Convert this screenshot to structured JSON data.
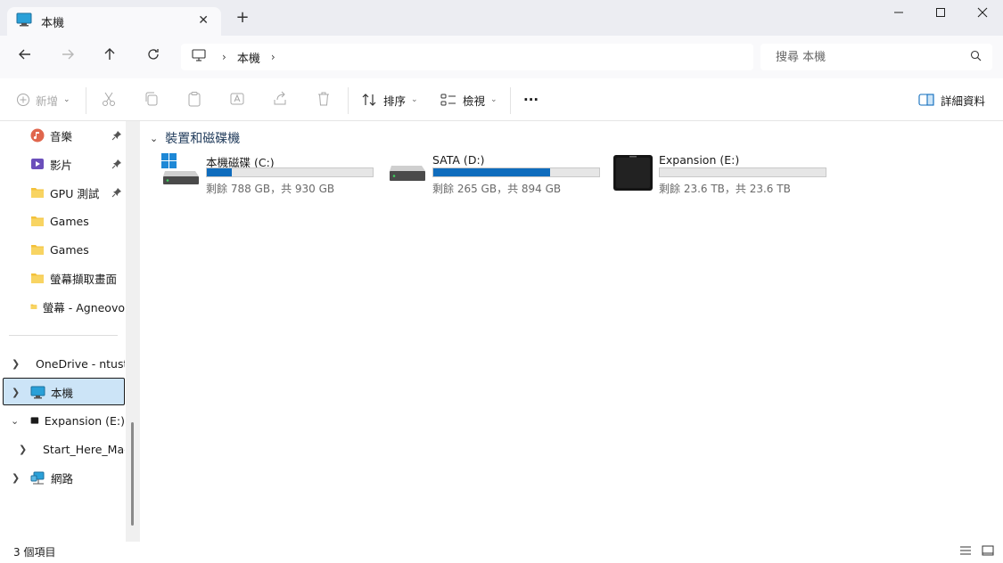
{
  "window": {
    "tab_title": "本機",
    "tab_close": "✕",
    "new_tab": "+"
  },
  "address": {
    "crumbs": [
      "本機"
    ]
  },
  "search": {
    "placeholder": "搜尋 本機"
  },
  "toolbar": {
    "new_label": "新增",
    "sort_label": "排序",
    "view_label": "檢視",
    "more_label": "···",
    "details_label": "詳細資料"
  },
  "sidebar": {
    "quick_access": [
      {
        "label": "音樂",
        "icon": "music-icon",
        "pinned": true
      },
      {
        "label": "影片",
        "icon": "video-icon",
        "pinned": true
      },
      {
        "label": "GPU 測試",
        "icon": "folder-icon",
        "pinned": true
      },
      {
        "label": "Games",
        "icon": "folder-icon",
        "pinned": false
      },
      {
        "label": "Games",
        "icon": "folder-icon",
        "pinned": false
      },
      {
        "label": "螢幕擷取畫面",
        "icon": "folder-icon",
        "pinned": false
      },
      {
        "label": "螢幕 - Agneovo",
        "icon": "folder-icon",
        "pinned": false
      }
    ],
    "tree": [
      {
        "label": "OneDrive - ntust",
        "icon": "onedrive-icon",
        "expanded": false
      },
      {
        "label": "本機",
        "icon": "computer-icon",
        "expanded": false,
        "selected": true
      },
      {
        "label": "Expansion (E:)",
        "icon": "external-drive-icon",
        "expanded": true
      },
      {
        "label": "Start_Here_Mac",
        "icon": "folder-icon",
        "expanded": false,
        "child": true
      },
      {
        "label": "網路",
        "icon": "network-icon",
        "expanded": false
      }
    ]
  },
  "content": {
    "group_title": "裝置和磁碟機",
    "drives": [
      {
        "name": "本機磁碟 (C:)",
        "free_text": "剩餘 788 GB，共 930 GB",
        "used_fraction": 0.153,
        "icon": "system-drive-icon"
      },
      {
        "name": "SATA (D:)",
        "free_text": "剩餘 265 GB，共 894 GB",
        "used_fraction": 0.704,
        "icon": "hard-drive-icon"
      },
      {
        "name": "Expansion (E:)",
        "free_text": "剩餘 23.6 TB，共 23.6 TB",
        "used_fraction": 0.0,
        "icon": "external-drive-icon"
      }
    ]
  },
  "status": {
    "item_count": "3 個項目"
  },
  "colors": {
    "accent": "#0f6cbd",
    "selection": "#cce4f7",
    "folder": "#f3c13a"
  }
}
